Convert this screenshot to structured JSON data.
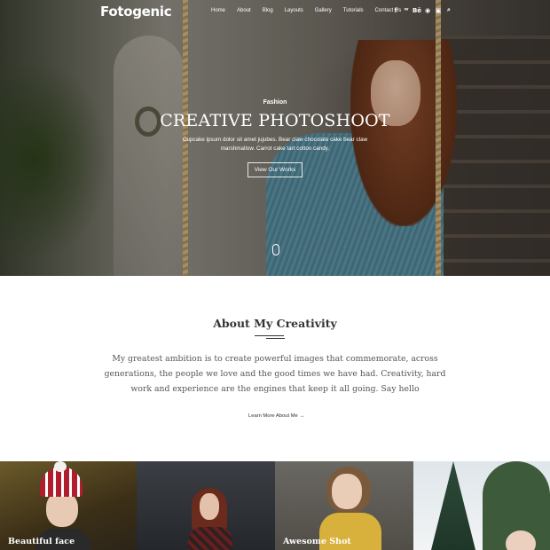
{
  "header": {
    "logo": "Fotogenic",
    "menu": [
      "Home",
      "About",
      "Blog",
      "Layouts",
      "Gallery",
      "Tutorials",
      "Contact Us"
    ],
    "social_icons": [
      "facebook-icon",
      "twitter-icon",
      "behance-icon",
      "github-icon",
      "instagram-icon",
      "search-icon"
    ],
    "social_glyphs": [
      "f",
      "ᵂ",
      "Bē",
      "◉",
      "▣",
      "⌕"
    ]
  },
  "hero": {
    "category": "Fashion",
    "title": "CREATIVE PHOTOSHOOT",
    "description": "Cupcake ipsum dolor sit amet jujubes. Bear claw chocolate cake bear claw marshmallow. Carrot cake tart cotton candy.",
    "button_label": "View Our Works"
  },
  "about": {
    "title": "About My Creativity",
    "text": "My greatest ambition is to create powerful images that commemorate, across generations, the people we love and the good times we have had. Creativity, hard work and experience are the engines that keep it all going. Say hello",
    "link_label": "Learn More About Me",
    "link_arrow": "→"
  },
  "gallery": {
    "captions": [
      "Beautiful face",
      "",
      "Awesome Shot",
      ""
    ]
  }
}
